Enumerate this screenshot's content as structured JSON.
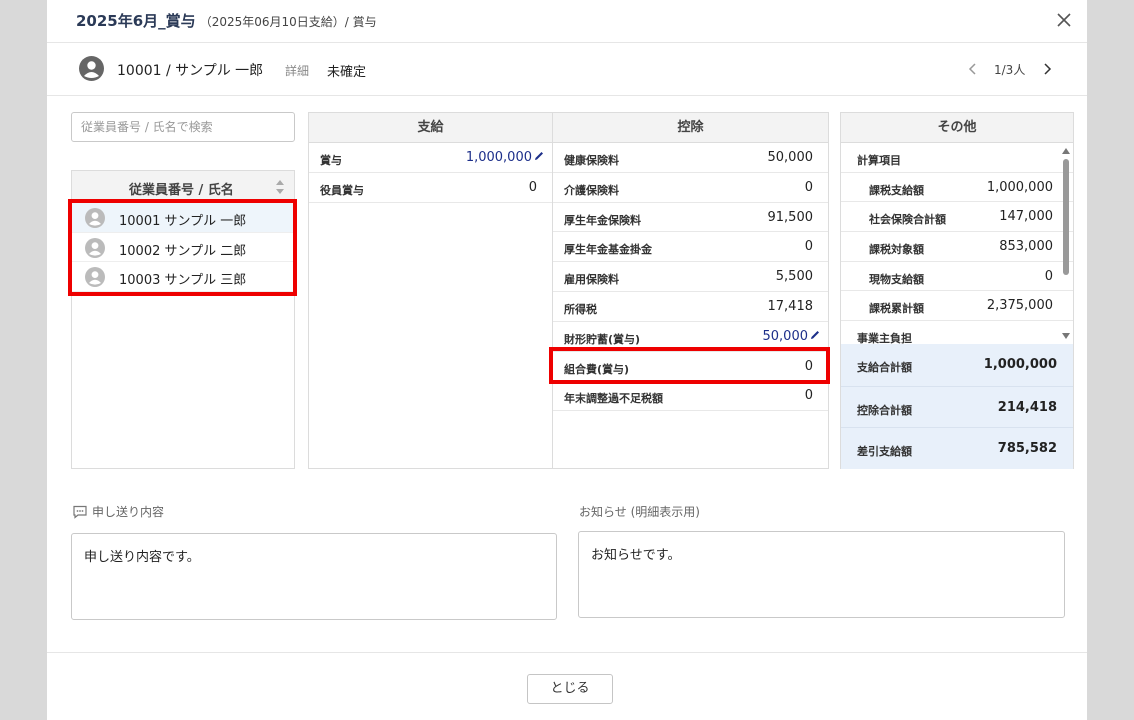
{
  "header": {
    "title": "2025年6月_賞与",
    "subtitle": "（2025年06月10日支給）/ 賞与",
    "close_icon": "close-icon"
  },
  "employee_bar": {
    "name": "10001 / サンプル 一郎",
    "detail_link": "詳細",
    "status": "未確定",
    "pager": "1/3人"
  },
  "search": {
    "placeholder": "従業員番号 / 氏名で検索",
    "value": ""
  },
  "employee_list": {
    "header": "従業員番号 / 氏名",
    "items": [
      {
        "label": "10001  サンプル 一郎"
      },
      {
        "label": "10002  サンプル 二郎"
      },
      {
        "label": "10003  サンプル 三郎"
      }
    ]
  },
  "payment": {
    "title": "支給",
    "rows": [
      {
        "label": "賞与",
        "value": "1,000,000"
      },
      {
        "label": "役員賞与",
        "value": "0"
      }
    ]
  },
  "deduction": {
    "title": "控除",
    "rows": [
      {
        "label": "健康保険料",
        "value": "50,000"
      },
      {
        "label": "介護保険料",
        "value": "0"
      },
      {
        "label": "厚生年金保険料",
        "value": "91,500"
      },
      {
        "label": "厚生年金基金掛金",
        "value": "0"
      },
      {
        "label": "雇用保険料",
        "value": "5,500"
      },
      {
        "label": "所得税",
        "value": "17,418"
      },
      {
        "label": "財形貯蓄(賞与)",
        "value": "50,000"
      },
      {
        "label": "組合費(賞与)",
        "value": "0"
      },
      {
        "label": "年末調整過不足税額",
        "value": "0"
      }
    ]
  },
  "other": {
    "title": "その他",
    "section_calc": "計算項目",
    "rows": [
      {
        "label": "課税支給額",
        "value": "1,000,000"
      },
      {
        "label": "社会保険合計額",
        "value": "147,000"
      },
      {
        "label": "課税対象額",
        "value": "853,000"
      },
      {
        "label": "現物支給額",
        "value": "0"
      },
      {
        "label": "課税累計額",
        "value": "2,375,000"
      }
    ],
    "section_employer": "事業主負担",
    "totals": [
      {
        "label": "支給合計額",
        "value": "1,000,000"
      },
      {
        "label": "控除合計額",
        "value": "214,418"
      },
      {
        "label": "差引支給額",
        "value": "785,582"
      }
    ]
  },
  "memo": {
    "label": "申し送り内容",
    "value": "申し送り内容です。"
  },
  "notice": {
    "label": "お知らせ (明細表示用)",
    "value": "お知らせです。"
  },
  "footer": {
    "close_button": "とじる"
  },
  "colors": {
    "title": "#2b3a57",
    "highlight": "#e00000",
    "totals_bg": "#e8f0fa",
    "edit_value": "#1d2f8a"
  }
}
